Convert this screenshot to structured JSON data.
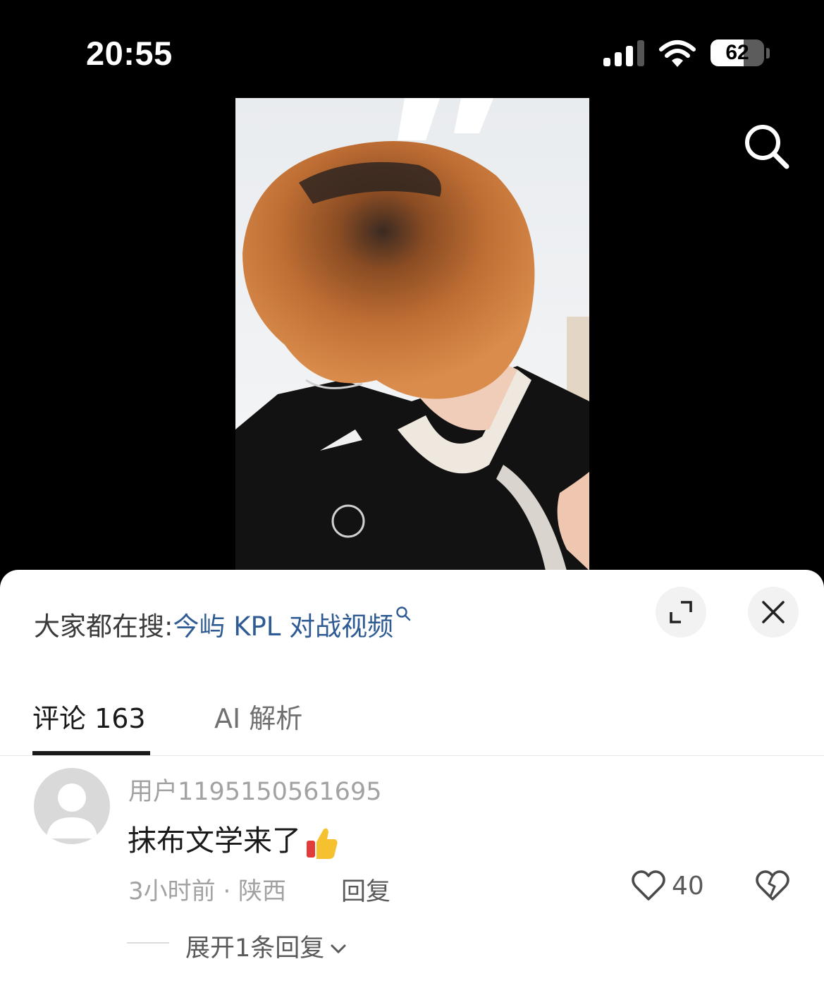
{
  "status_bar": {
    "time": "20:55",
    "battery_level": "62",
    "battery_fraction": 0.62,
    "signal_bars_active": 3,
    "signal_bars_total": 4
  },
  "video": {
    "description_icon": "video-frame"
  },
  "search_hint": {
    "label": "大家都在搜:",
    "keyword": "今屿 KPL 对战视频"
  },
  "tabs": [
    {
      "label": "评论 163",
      "active": true
    },
    {
      "label": "AI 解析",
      "active": false
    }
  ],
  "comment": {
    "username": "用户1195150561695",
    "text": "抹布文学来了",
    "meta": "3小时前 · 陕西",
    "reply_label": "回复",
    "like_count": "40",
    "expand_label": "展开1条回复"
  },
  "colors": {
    "accent_link": "#2e5b93",
    "sheet_bg": "#ffffff",
    "screen_bg": "#000000"
  },
  "icons": [
    "signal-icon",
    "wifi-icon",
    "battery-icon",
    "search-icon",
    "expand-icon",
    "close-icon",
    "avatar-placeholder-icon",
    "thumbs-up-emoji",
    "heart-icon",
    "broken-heart-icon",
    "chevron-down-icon"
  ]
}
